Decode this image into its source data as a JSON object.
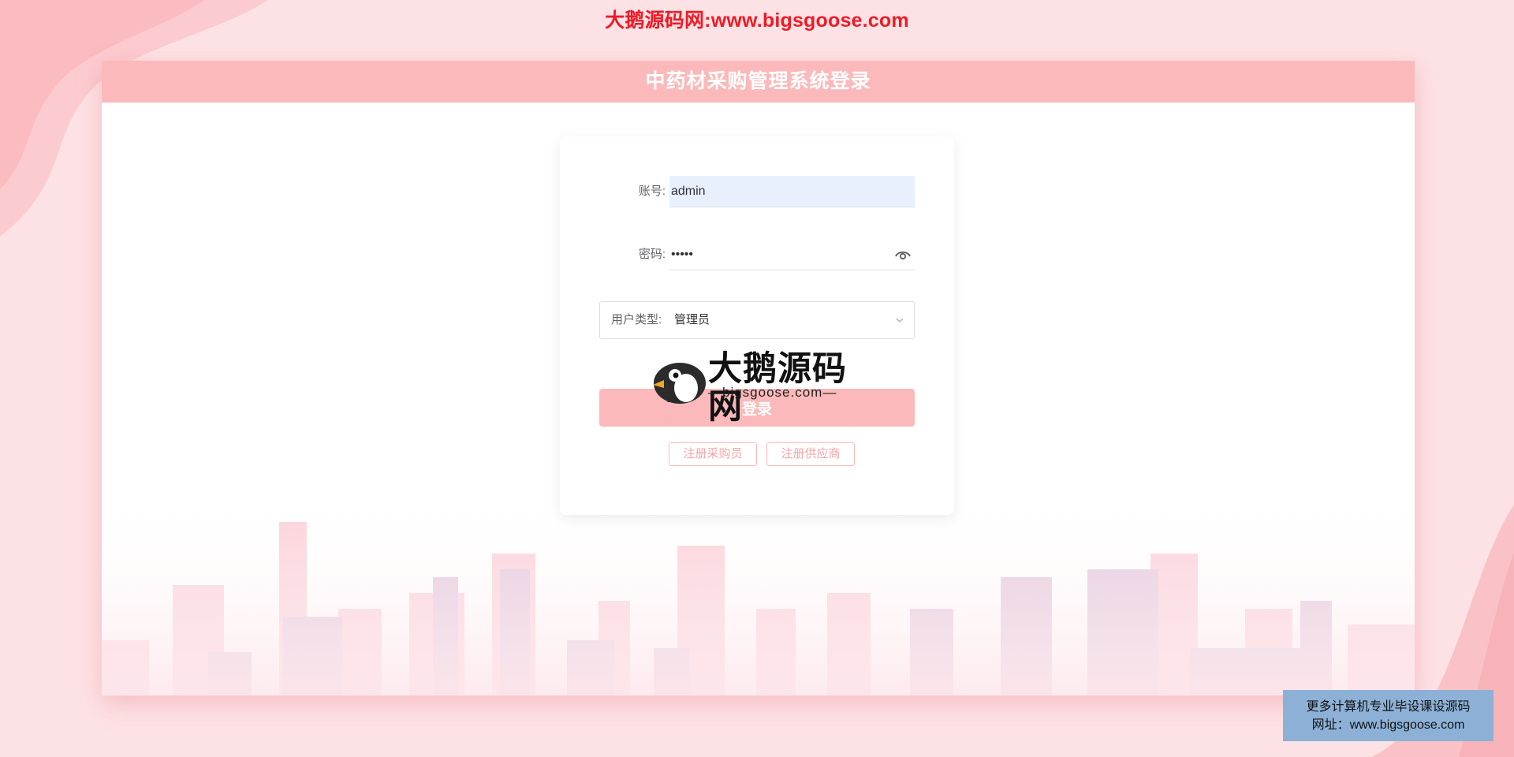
{
  "banner": {
    "text": "大鹅源码网:www.bigsgoose.com"
  },
  "panel": {
    "title": "中药材采购管理系统登录"
  },
  "form": {
    "account_label": "账号:",
    "account_value": "admin",
    "password_label": "密码:",
    "password_value": "•••••",
    "user_type_prefix": "用户类型:",
    "user_type_value": "管理员",
    "login_label": "登录",
    "register_buyer_label": "注册采购员",
    "register_supplier_label": "注册供应商"
  },
  "watermark": {
    "title": "大鹅源码网",
    "subtitle": "—bigsgoose.com—"
  },
  "corner_ad": {
    "line1": "更多计算机专业毕设课设源码",
    "line2": "网址：www.bigsgoose.com"
  },
  "icons": {
    "password_toggle": "eye-icon",
    "select_arrow": "chevron-down-icon",
    "logo": "goose-icon"
  },
  "colors": {
    "background": "#fde2e5",
    "accent_pink": "#fbb9bb",
    "banner_red": "#f01a26",
    "autofill_blue": "#e8f0fe",
    "ad_blue": "#8db1d6"
  }
}
